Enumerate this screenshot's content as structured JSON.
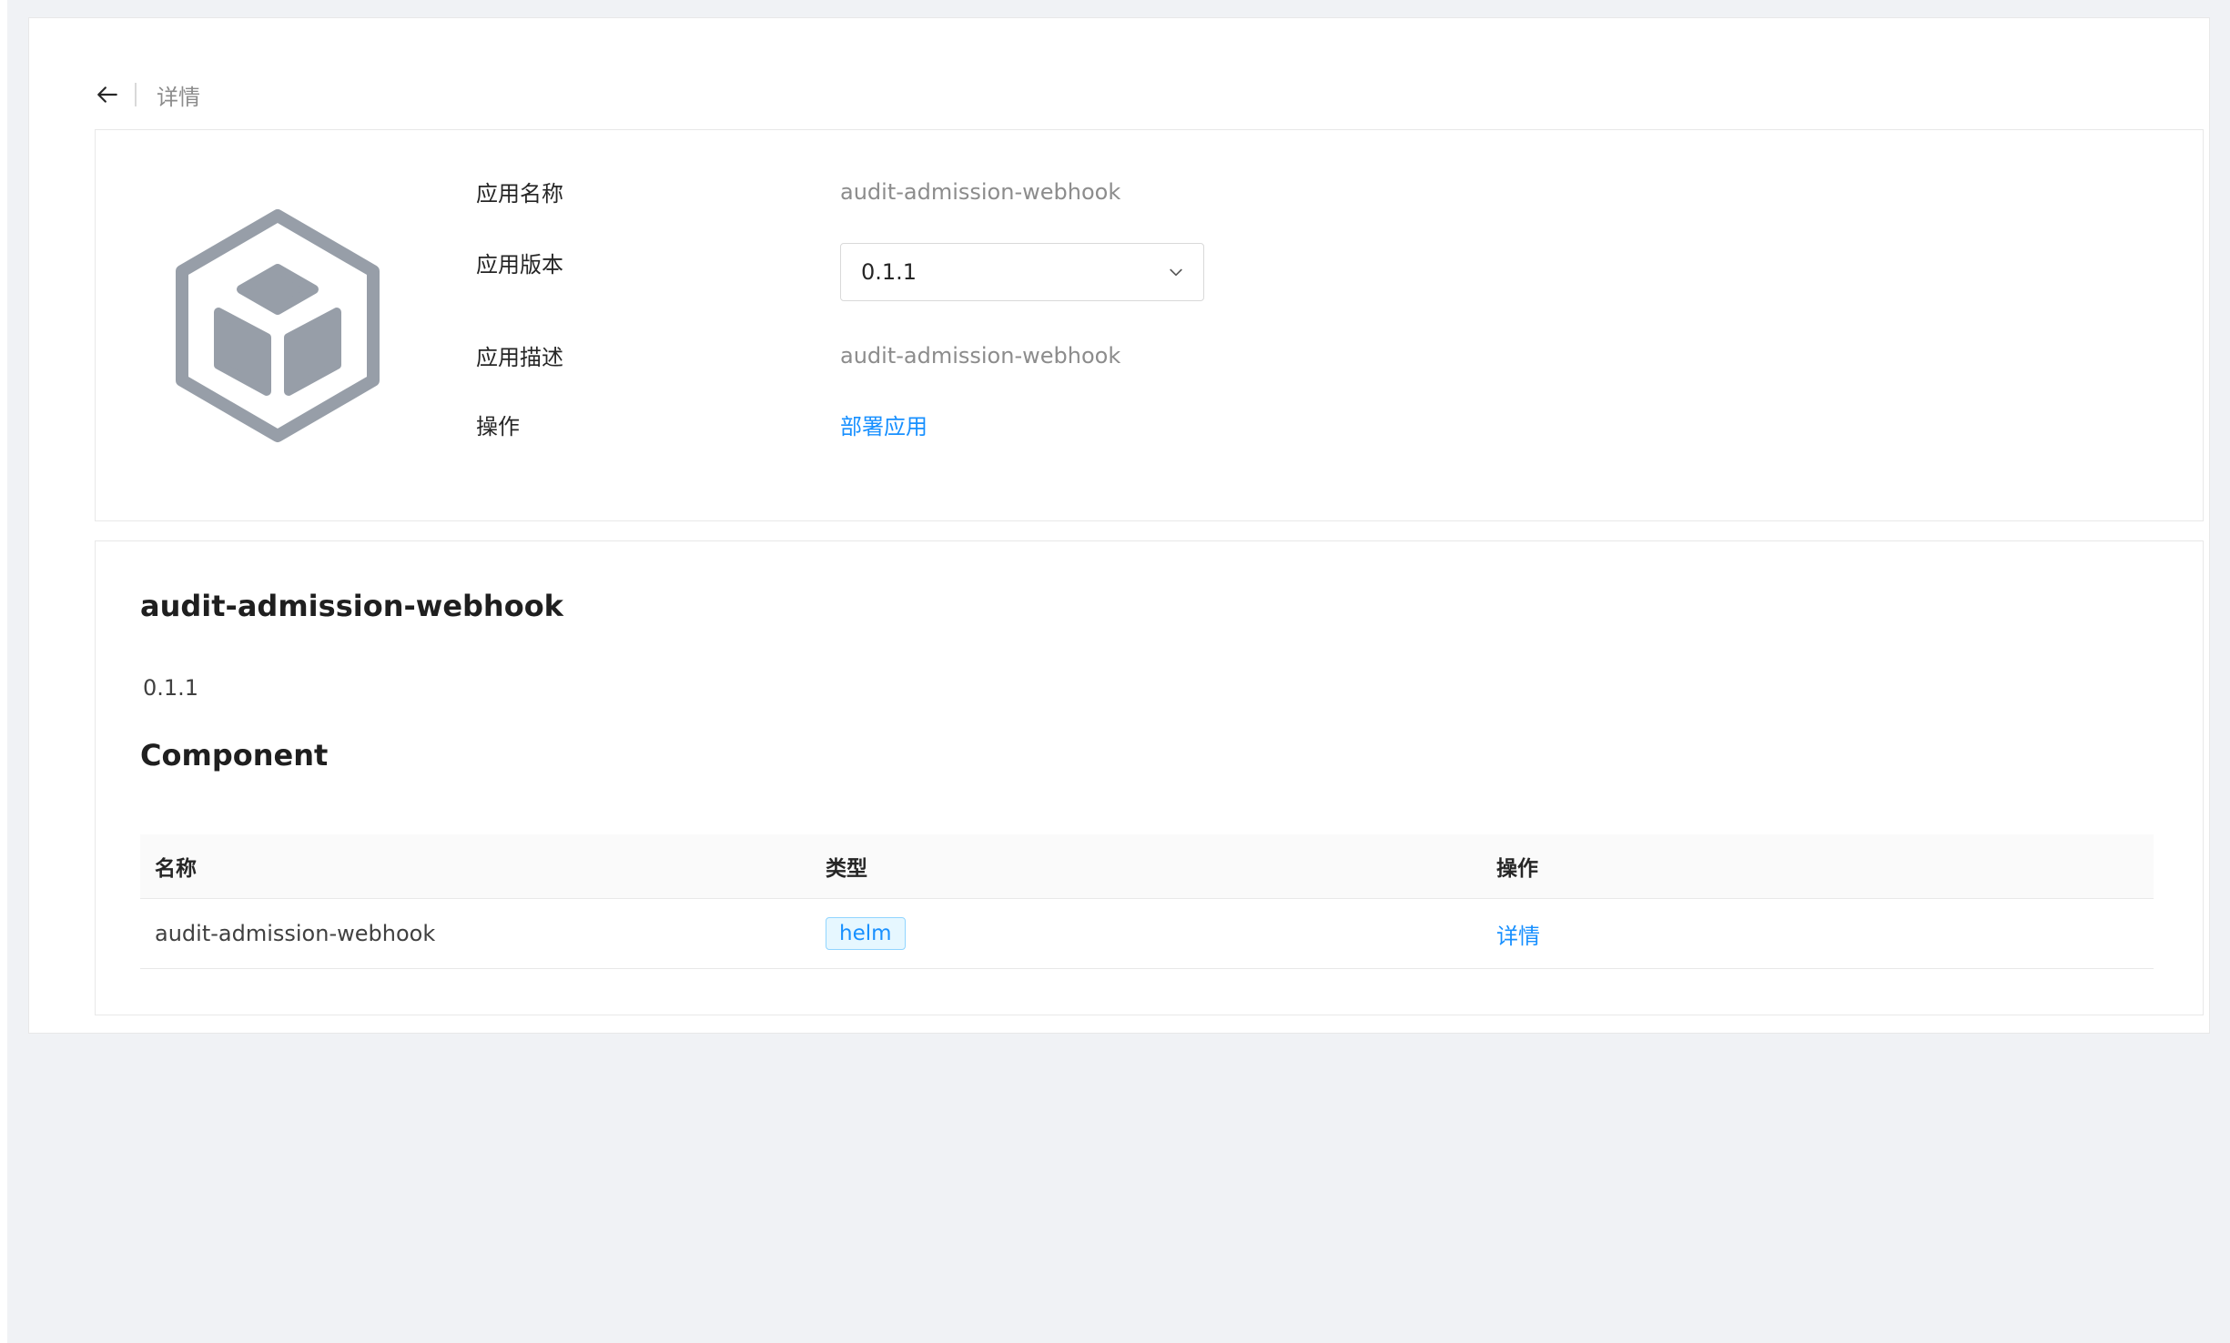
{
  "header": {
    "title": "详情"
  },
  "app_info": {
    "name_label": "应用名称",
    "name_value": "audit-admission-webhook",
    "version_label": "应用版本",
    "version_selected": "0.1.1",
    "description_label": "应用描述",
    "description_value": "audit-admission-webhook",
    "action_label": "操作",
    "action_link": "部署应用"
  },
  "detail": {
    "title": "audit-admission-webhook",
    "version": "0.1.1",
    "section_title": "Component",
    "table": {
      "columns": [
        "名称",
        "类型",
        "操作"
      ],
      "rows": [
        {
          "name": "audit-admission-webhook",
          "type": "helm",
          "action": "详情"
        }
      ]
    }
  },
  "colors": {
    "link": "#1890ff",
    "tag_bg": "#e6f7ff",
    "tag_border": "#91d5ff",
    "logo": "#979ea8"
  },
  "icons": {
    "back": "arrow-left-icon",
    "select": "chevron-down-icon",
    "logo": "cube-package-icon"
  }
}
